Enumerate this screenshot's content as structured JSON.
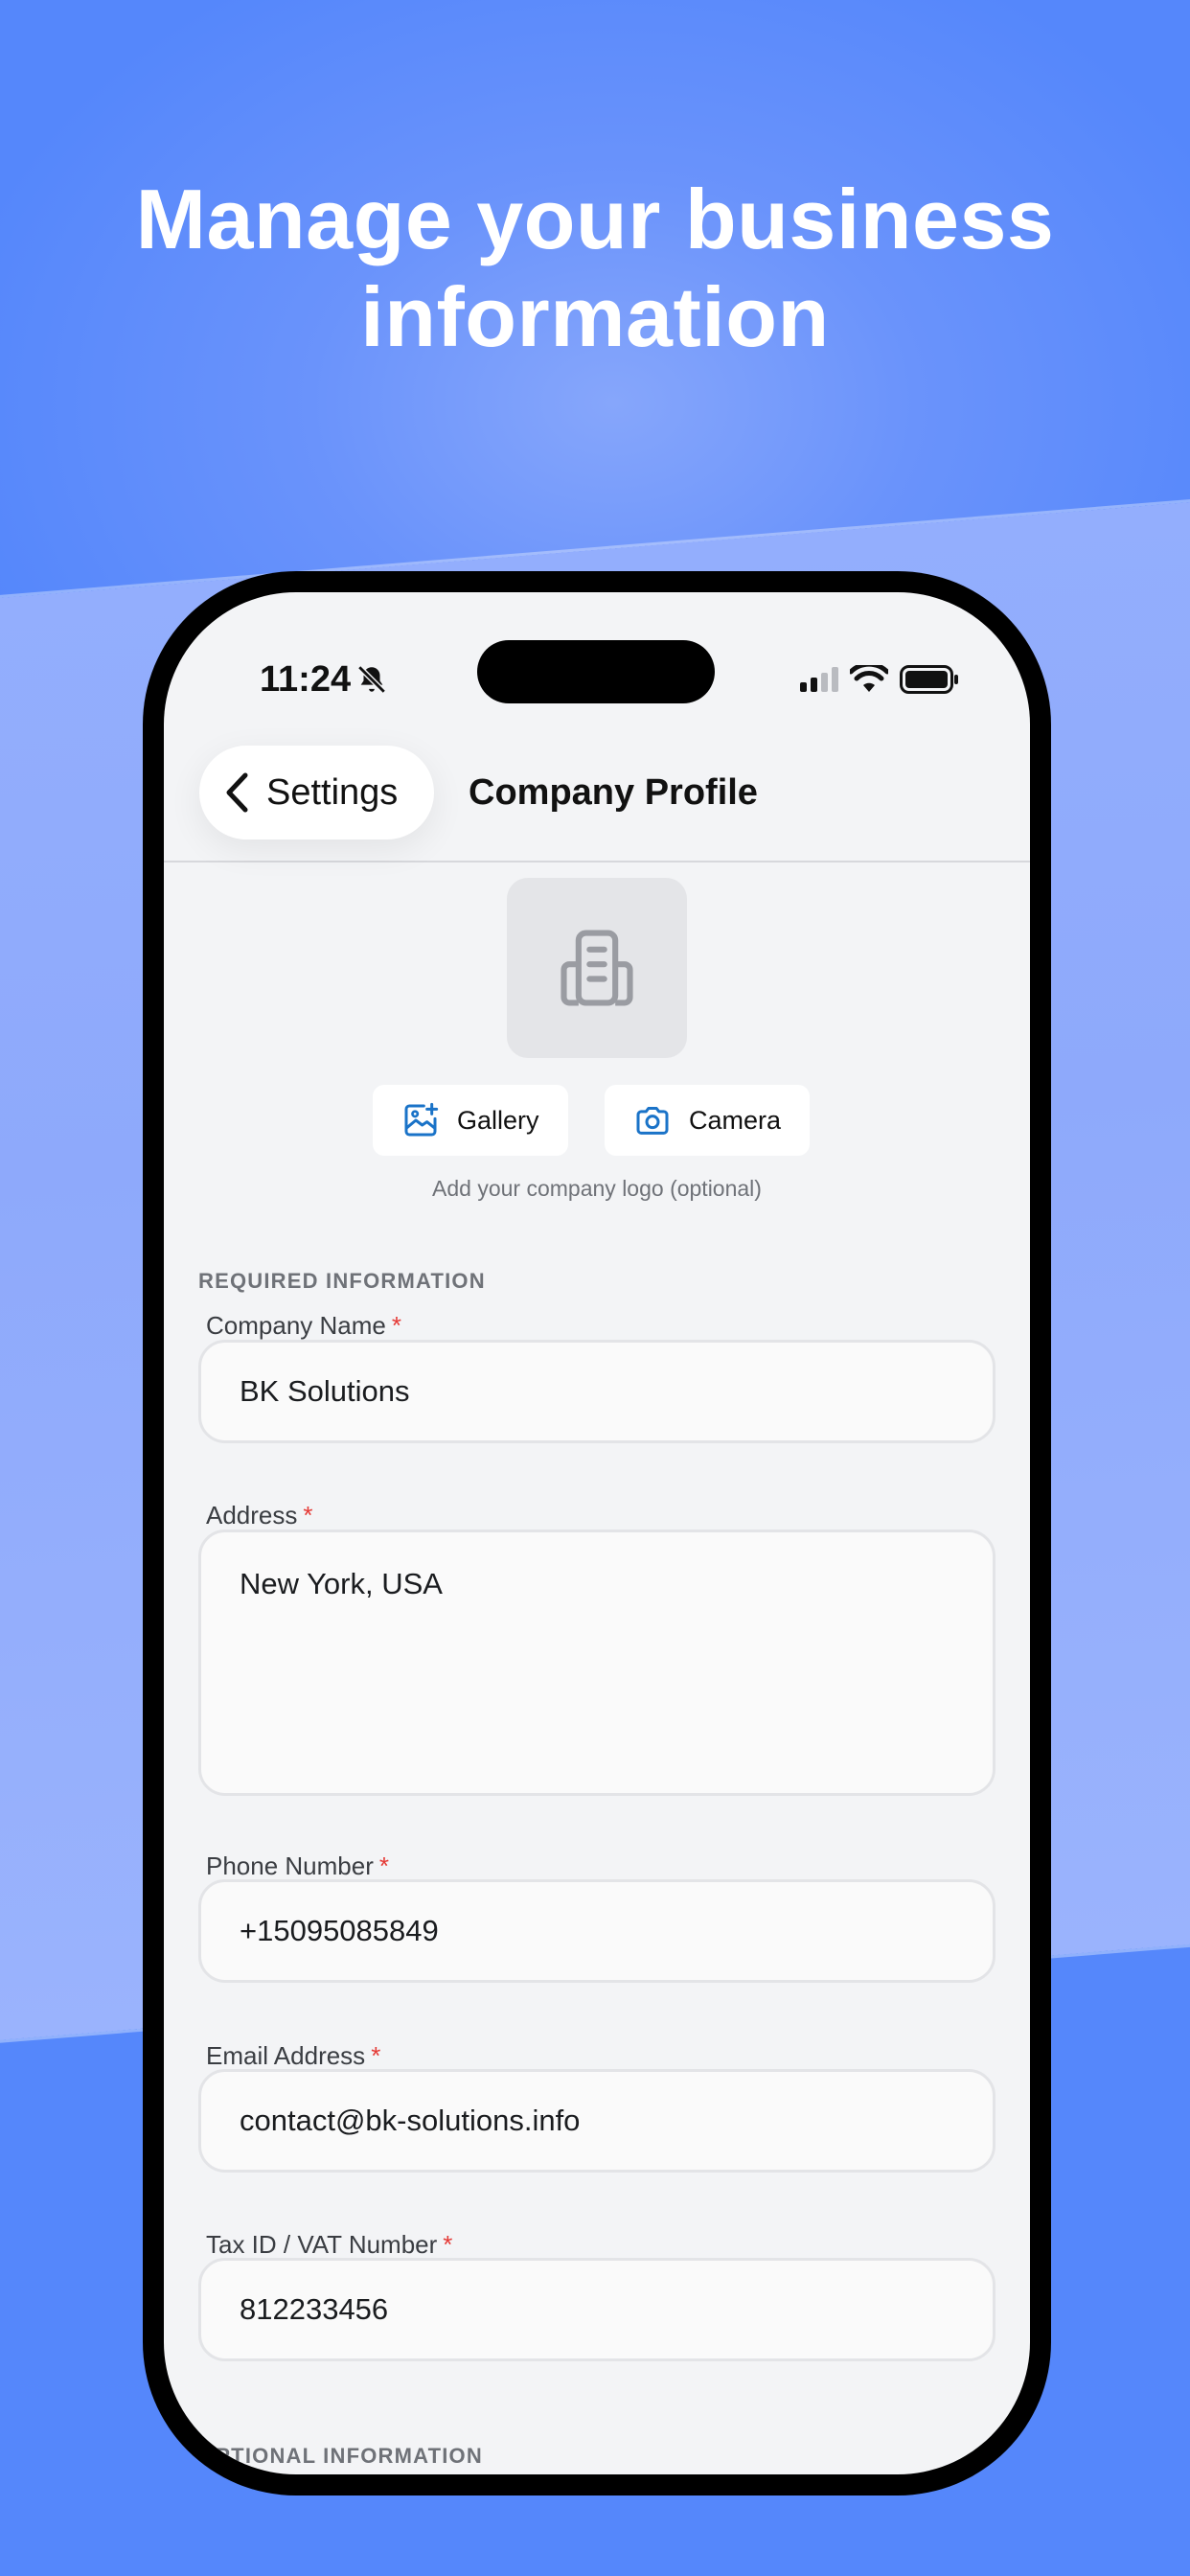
{
  "headline": "Manage your business information",
  "status": {
    "time": "11:24"
  },
  "nav": {
    "back_label": "Settings",
    "title": "Company Profile"
  },
  "media": {
    "gallery_label": "Gallery",
    "camera_label": "Camera",
    "hint": "Add your company logo (optional)"
  },
  "sections": {
    "required": "REQUIRED INFORMATION",
    "optional": "OPTIONAL INFORMATION"
  },
  "required_marker": "*",
  "fields": {
    "company_name": {
      "label": "Company Name",
      "value": "BK Solutions"
    },
    "address": {
      "label": "Address",
      "value": "New York, USA"
    },
    "phone": {
      "label": "Phone Number",
      "value": "+15095085849"
    },
    "email": {
      "label": "Email Address",
      "value": "contact@bk-solutions.info"
    },
    "tax_id": {
      "label": "Tax ID / VAT Number",
      "value": "812233456"
    }
  },
  "colors": {
    "accent": "#1a73c8",
    "required": "#e53935",
    "background_top": "#5587fb"
  }
}
